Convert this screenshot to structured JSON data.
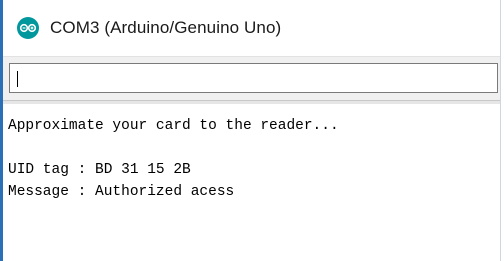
{
  "window": {
    "title": "COM3 (Arduino/Genuino Uno)",
    "icon": "arduino-icon"
  },
  "send": {
    "value": ""
  },
  "output": {
    "lines": [
      "Approximate your card to the reader...",
      "",
      "UID tag : BD 31 15 2B",
      "Message : Authorized acess"
    ]
  },
  "colors": {
    "frame": "#2b6fb6",
    "icon": "#00979d"
  }
}
